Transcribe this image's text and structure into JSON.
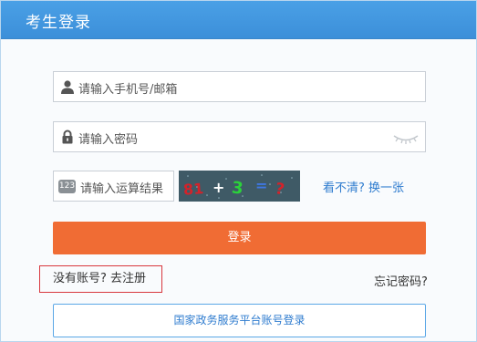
{
  "header": {
    "title": "考生登录"
  },
  "form": {
    "account_placeholder": "请输入手机号/邮箱",
    "password_placeholder": "请输入密码",
    "captcha_placeholder": "请输入运算结果",
    "captcha_badge": "123",
    "captcha_text": [
      "81",
      "+",
      "3",
      "=",
      "?"
    ],
    "refresh_label": "看不清? 换一张",
    "login_label": "登录",
    "register_label": "没有账号? 去注册",
    "forgot_label": "忘记密码?",
    "gov_login_label": "国家政务服务平台账号登录"
  },
  "colors": {
    "header": "#3c8fd9",
    "login_button": "#f06c34",
    "link": "#2f7ccf",
    "register_border": "#d8373d"
  }
}
